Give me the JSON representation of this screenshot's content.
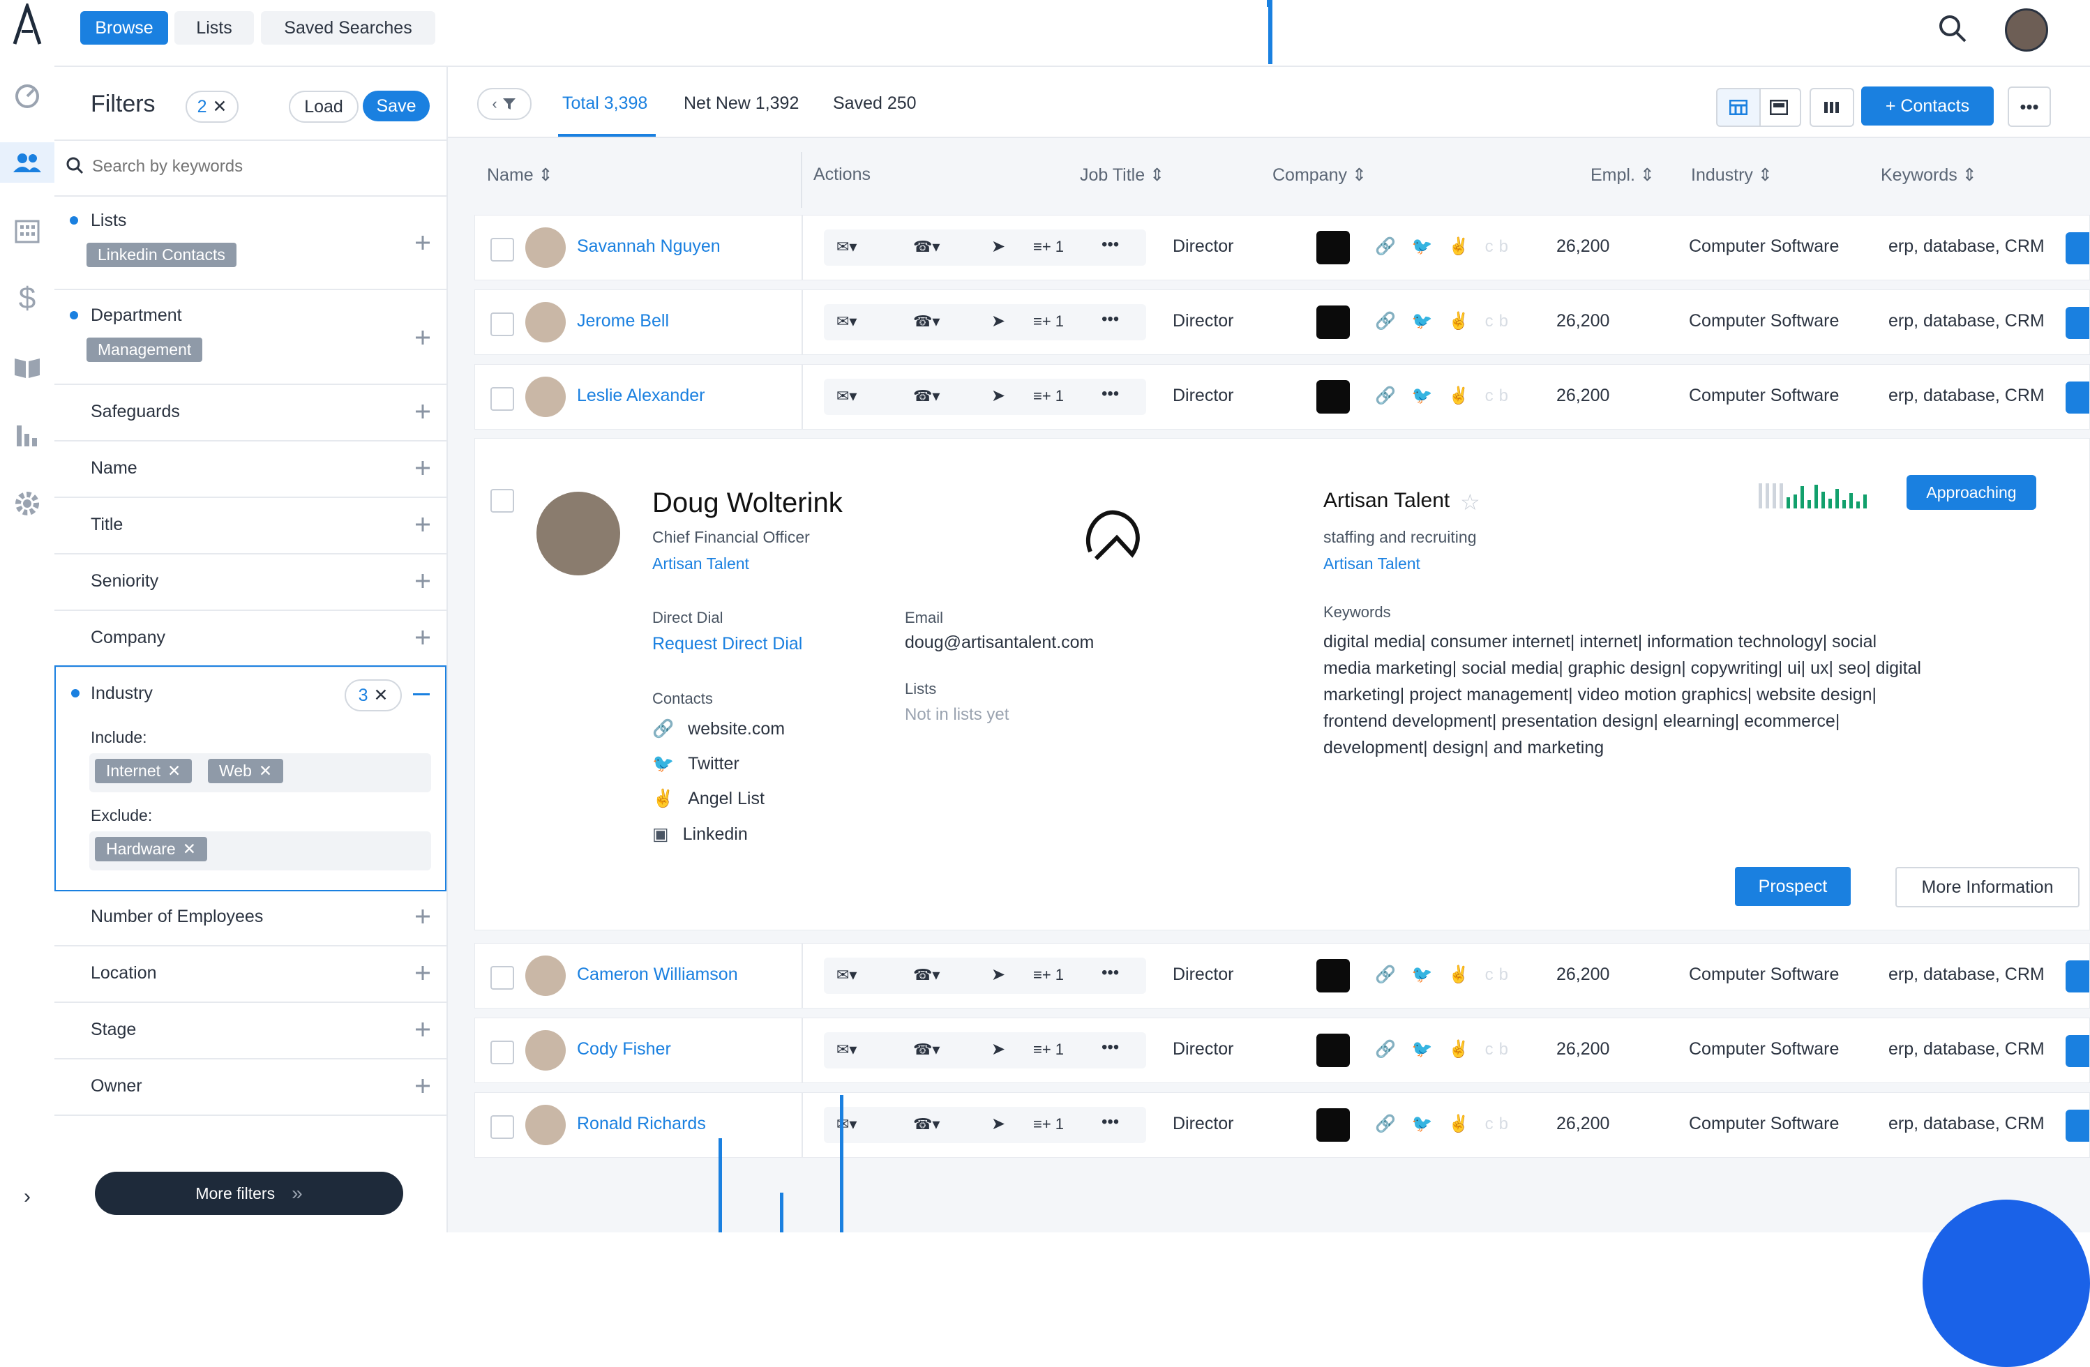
{
  "topbar": {
    "tabs": [
      "Browse",
      "Lists",
      "Saved Searches"
    ]
  },
  "filters": {
    "title": "Filters",
    "count": "2",
    "load_label": "Load",
    "save_label": "Save",
    "search_placeholder": "Search by keywords",
    "lists_label": "Lists",
    "lists_tag": "Linkedin Contacts",
    "department_label": "Department",
    "department_tag": "Management",
    "items": [
      "Safeguards",
      "Name",
      "Title",
      "Seniority",
      "Company"
    ],
    "industry": {
      "label": "Industry",
      "count": "3",
      "include_label": "Include:",
      "include_tags": [
        "Internet",
        "Web"
      ],
      "exclude_label": "Exclude:",
      "exclude_tags": [
        "Hardware"
      ]
    },
    "items_after": [
      "Number of Employees",
      "Location",
      "Stage",
      "Owner"
    ],
    "more_filters": "More filters"
  },
  "main": {
    "tabs": [
      "Total 3,398",
      "Net New 1,392",
      "Saved 250"
    ],
    "contacts_button": "+ Contacts",
    "columns": [
      "Name",
      "Actions",
      "Job Title",
      "Company",
      "Empl.",
      "Industry",
      "Keywords"
    ],
    "rows_top": [
      {
        "name": "Savannah Nguyen",
        "count": "1",
        "title": "Director",
        "empl": "26,200",
        "industry": "Computer Software",
        "keywords": "erp, database, CRM"
      },
      {
        "name": "Jerome Bell",
        "count": "1",
        "title": "Director",
        "empl": "26,200",
        "industry": "Computer Software",
        "keywords": "erp, database, CRM"
      },
      {
        "name": "Leslie Alexander",
        "count": "1",
        "title": "Director",
        "empl": "26,200",
        "industry": "Computer Software",
        "keywords": "erp, database, CRM"
      }
    ],
    "rows_bottom": [
      {
        "name": "Cameron Williamson",
        "count": "1",
        "title": "Director",
        "empl": "26,200",
        "industry": "Computer Software",
        "keywords": "erp, database, CRM"
      },
      {
        "name": "Cody Fisher",
        "count": "1",
        "title": "Director",
        "empl": "26,200",
        "industry": "Computer Software",
        "keywords": "erp, database, CRM"
      },
      {
        "name": "Ronald Richards",
        "count": "1",
        "title": "Director",
        "empl": "26,200",
        "industry": "Computer Software",
        "keywords": "erp, database, CRM"
      }
    ],
    "social_glyphs": "🔗 🐦 ✌ cb",
    "detail": {
      "name": "Doug Wolterink",
      "title": "Chief Financial Officer",
      "company": "Artisan Talent",
      "direct_dial_label": "Direct Dial",
      "direct_dial_action": "Request Direct Dial",
      "email_label": "Email",
      "email": "doug@artisantalent.com",
      "contacts_label": "Contacts",
      "contacts": [
        "website.com",
        "Twitter",
        "Angel List",
        "Linkedin"
      ],
      "lists_label": "Lists",
      "lists_value": "Not in lists yet",
      "company_name": "Artisan Talent",
      "company_desc": "staffing and recruiting",
      "company_link": "Artisan Talent",
      "stage_badge": "Approaching",
      "keywords_label": "Keywords",
      "keywords_lines": [
        "digital media| consumer internet| internet| information technology| social",
        "media marketing| social media| graphic design| copywriting| ui| ux| seo| digital",
        "marketing| project management| video motion graphics| website design|",
        "frontend development| presentation design| elearning| ecommerce|",
        "development| design| and marketing"
      ],
      "prospect_label": "Prospect",
      "more_info_label": "More Information"
    }
  },
  "colors": {
    "accent": "#1a80e0",
    "dark": "#1e2a3a",
    "chip": "#8f9aa8"
  }
}
